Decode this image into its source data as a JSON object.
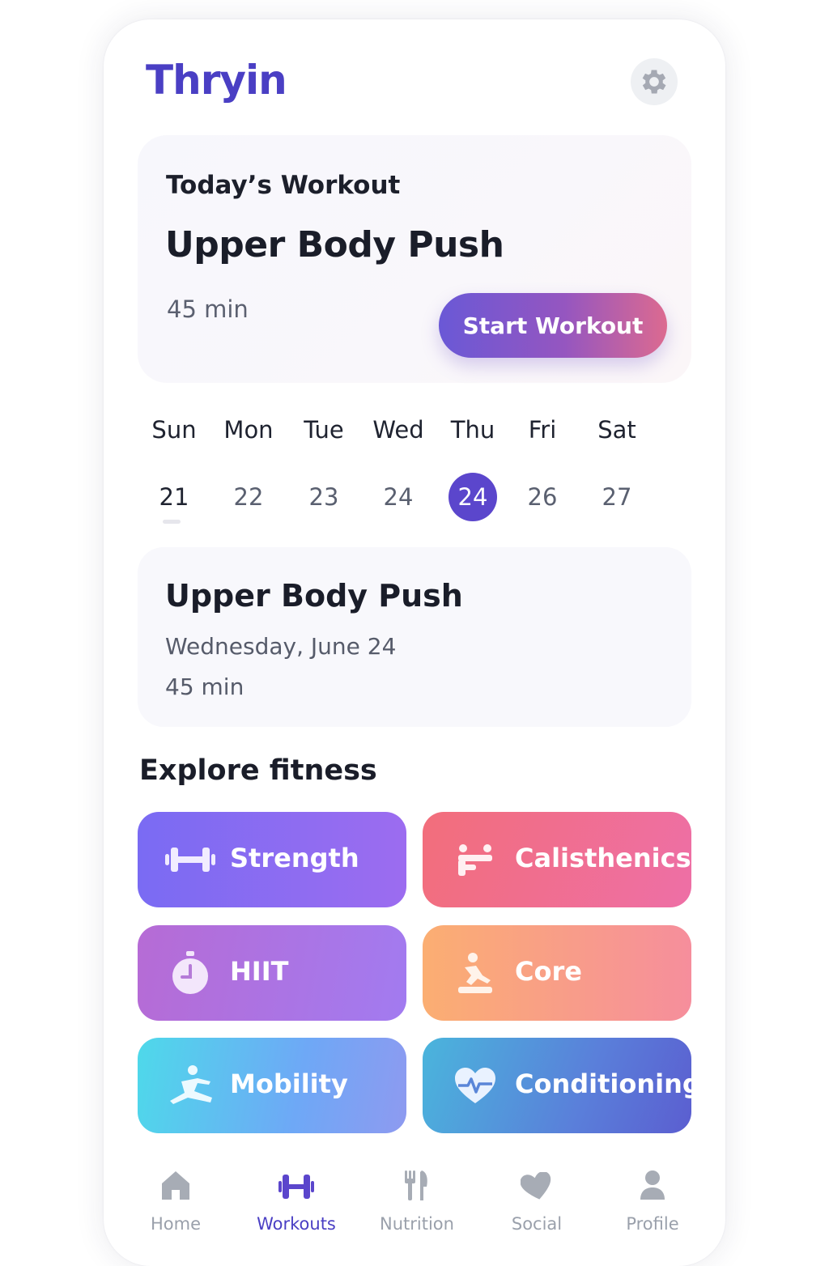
{
  "app": {
    "title": "Thryin"
  },
  "header": {
    "settings_icon": "gear-icon"
  },
  "today": {
    "label": "Today’s Workout",
    "name": "Upper Body Push",
    "duration": "45 min",
    "start_label": "Start Workout"
  },
  "week": {
    "days": [
      {
        "name": "Sun",
        "num": "21"
      },
      {
        "name": "Mon",
        "num": "22"
      },
      {
        "name": "Tue",
        "num": "23"
      },
      {
        "name": "Wed",
        "num": "24"
      },
      {
        "name": "Thu",
        "num": "24"
      },
      {
        "name": "Fri",
        "num": "26"
      },
      {
        "name": "Sat",
        "num": "27"
      }
    ],
    "selected_index": 4
  },
  "detail": {
    "name": "Upper Body Push",
    "date": "Wednesday, June 24",
    "duration": "45 min"
  },
  "explore": {
    "title": "Explore fitness",
    "categories": [
      {
        "label": "Strength",
        "icon": "dumbbell-icon"
      },
      {
        "label": "Calisthenics",
        "icon": "calisthenics-icon"
      },
      {
        "label": "HIIT",
        "icon": "stopwatch-icon"
      },
      {
        "label": "Core",
        "icon": "core-pose-icon"
      },
      {
        "label": "Mobility",
        "icon": "stretch-icon"
      },
      {
        "label": "Conditioning",
        "icon": "heartbeat-icon"
      }
    ]
  },
  "nav": {
    "items": [
      {
        "label": "Home",
        "icon": "home-icon"
      },
      {
        "label": "Workouts",
        "icon": "dumbbell-icon"
      },
      {
        "label": "Nutrition",
        "icon": "fork-knife-icon"
      },
      {
        "label": "Social",
        "icon": "heart-icon"
      },
      {
        "label": "Profile",
        "icon": "person-icon"
      }
    ],
    "active_index": 1
  },
  "colors": {
    "brand": "#4a3fc4",
    "selected_day": "#5b46cc",
    "nav_inactive": "#9aa0ab"
  }
}
